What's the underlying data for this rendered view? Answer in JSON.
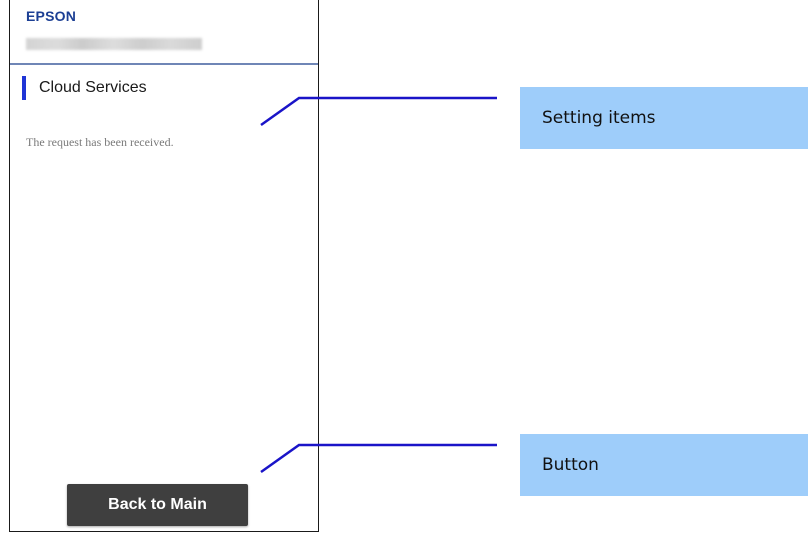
{
  "screen": {
    "brand": "EPSON",
    "section_title": "Cloud Services",
    "message": "The request has been received.",
    "back_button_label": "Back to Main"
  },
  "callouts": {
    "setting_items": "Setting items",
    "button": "Button"
  },
  "colors": {
    "brand_blue": "#1c3f94",
    "accent_bar": "#1f35d6",
    "callout_line": "#1a14c8",
    "callout_fill": "#9ecdfa",
    "button_bg": "#3f3f3f"
  }
}
